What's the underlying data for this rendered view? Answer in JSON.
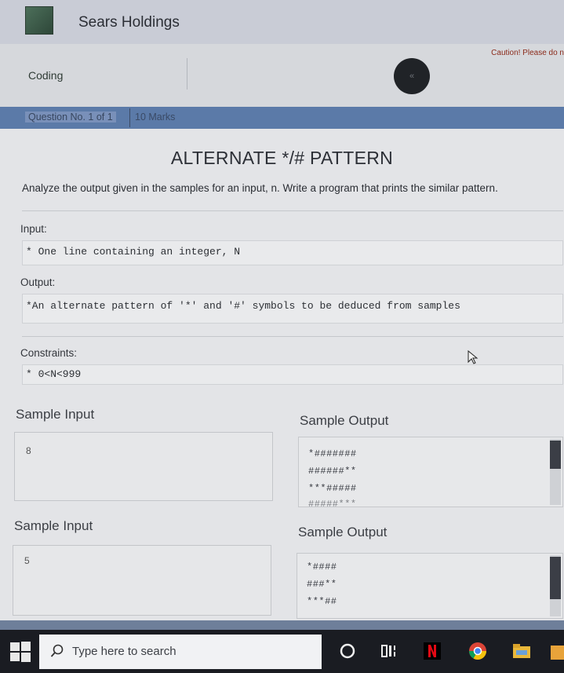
{
  "header": {
    "company": "Sears Holdings"
  },
  "toolbar": {
    "section": "Coding",
    "caution": "Caution! Please do n",
    "collapse": "«"
  },
  "question": {
    "number": "Question No. 1 of 1",
    "marks": "10 Marks"
  },
  "problem": {
    "title": "ALTERNATE */# PATTERN",
    "description": "Analyze the output given in the samples for an input, n. Write a program that prints the similar pattern.",
    "input_label": "Input:",
    "input_text": "* One line containing an integer, N",
    "output_label": "Output:",
    "output_text": "*An alternate pattern of '*' and '#' symbols to be deduced from samples",
    "constraints_label": "Constraints:",
    "constraints_text": "* 0<N<999"
  },
  "samples": [
    {
      "input_label": "Sample Input",
      "output_label": "Sample Output",
      "input_value": "8",
      "output_lines": [
        "*#######",
        "######**",
        "***#####",
        "#####***"
      ]
    },
    {
      "input_label": "Sample Input",
      "output_label": "Sample Output",
      "input_value": "5",
      "output_lines": [
        "*####",
        "###**",
        "***##"
      ]
    }
  ],
  "taskbar": {
    "search_placeholder": "Type here to search"
  },
  "colors": {
    "header_bar": "#c9ccd6",
    "question_bar": "#5b7aa8",
    "taskbar": "#1a1c22"
  }
}
